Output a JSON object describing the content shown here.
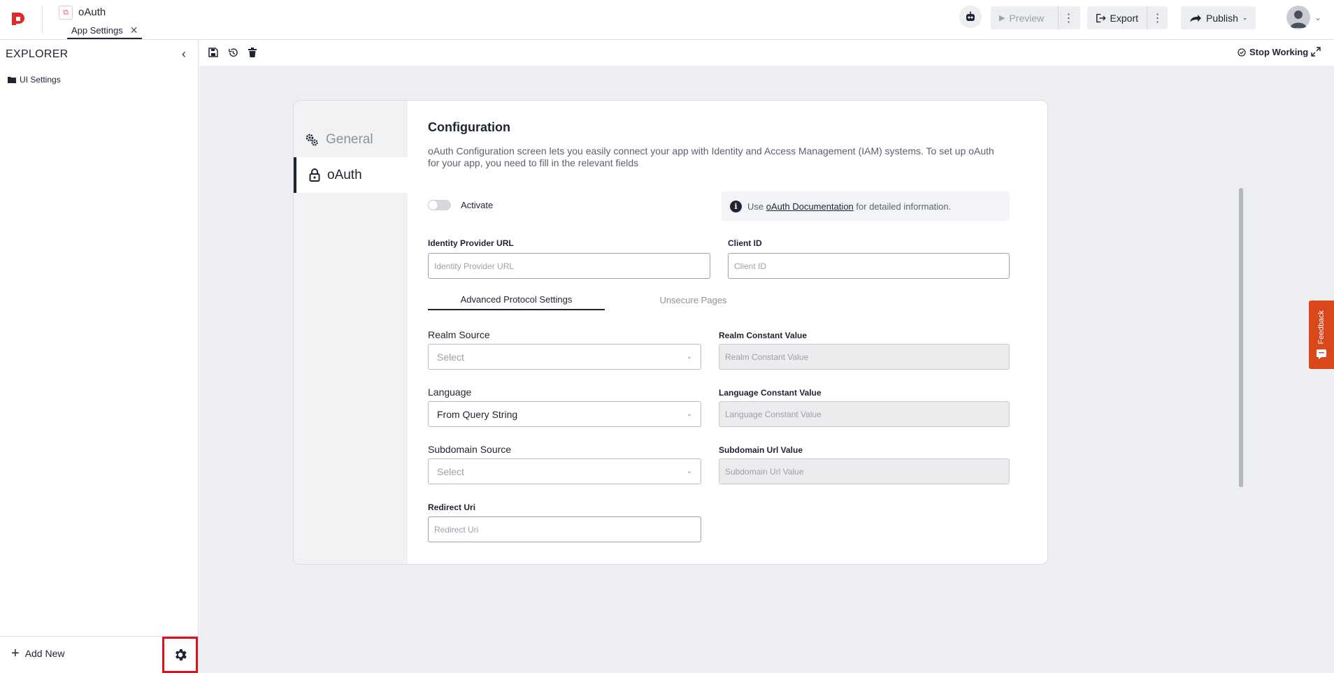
{
  "header": {
    "app_title": "oAuth",
    "tab_label": "App Settings",
    "tab_close": "✕",
    "preview_label": "Preview",
    "export_label": "Export",
    "publish_label": "Publish"
  },
  "sidebar": {
    "title": "EXPLORER",
    "items": [
      {
        "label": "UI Settings"
      }
    ],
    "add_new_label": "Add New"
  },
  "workspace": {
    "stop_working_label": "Stop Working"
  },
  "settings": {
    "nav": [
      {
        "label": "General",
        "icon": "gears-icon",
        "active": false
      },
      {
        "label": "oAuth",
        "icon": "lock-icon",
        "active": true
      }
    ],
    "title": "Configuration",
    "description": "oAuth Configuration screen lets you easily connect your app with Identity and Access Management (IAM) systems. To set up oAuth for your app, you need to fill in the relevant fields",
    "activate_label": "Activate",
    "activate_on": false,
    "info": {
      "prefix": "Use",
      "link": "oAuth Documentation",
      "suffix": "for detailed information."
    },
    "fields": {
      "identity_provider_url": {
        "label": "Identity Provider URL",
        "placeholder": "Identity Provider URL",
        "value": ""
      },
      "client_id": {
        "label": "Client ID",
        "placeholder": "Client ID",
        "value": ""
      },
      "realm_source": {
        "label": "Realm Source",
        "value": "Select"
      },
      "realm_constant": {
        "label": "Realm Constant Value",
        "placeholder": "Realm Constant Value"
      },
      "language": {
        "label": "Language",
        "value": "From Query String"
      },
      "language_constant": {
        "label": "Language Constant Value",
        "placeholder": "Language Constant Value"
      },
      "subdomain_source": {
        "label": "Subdomain Source",
        "value": "Select"
      },
      "subdomain_url": {
        "label": "Subdomain Url Value",
        "placeholder": "Subdomain Url Value"
      },
      "redirect_uri": {
        "label": "Redirect Uri",
        "placeholder": "Redirect Uri"
      }
    },
    "subtabs": [
      {
        "label": "Advanced Protocol Settings",
        "active": true
      },
      {
        "label": "Unsecure Pages",
        "active": false
      }
    ]
  },
  "feedback_label": "Feedback",
  "colors": {
    "primary": "#1f2433",
    "feedback": "#d9481b",
    "highlight_border": "#e0101f",
    "workspace_bg": "#eceef1"
  }
}
